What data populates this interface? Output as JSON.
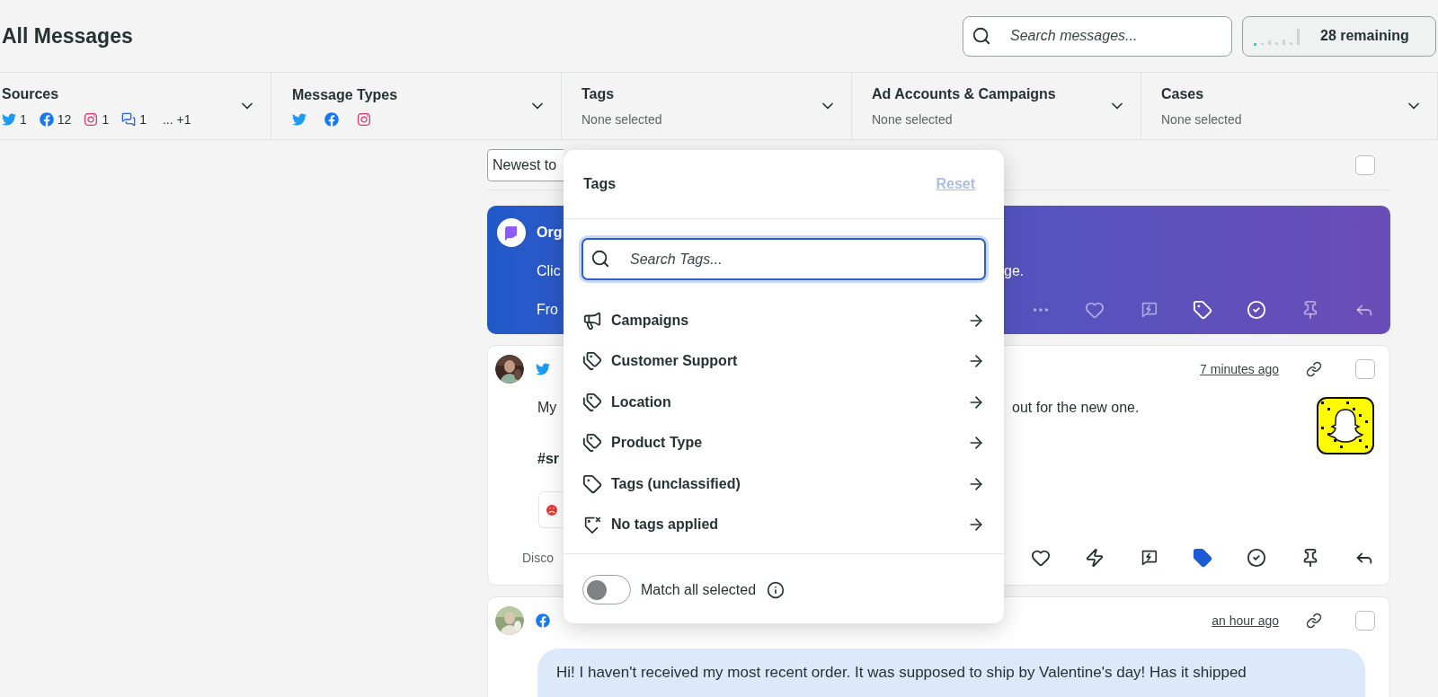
{
  "header": {
    "title": "All Messages",
    "search": {
      "placeholder": "Search messages..."
    },
    "remaining": {
      "label": "28 remaining"
    }
  },
  "filters": [
    {
      "title": "Sources",
      "kind": "sources",
      "sources": [
        {
          "kind": "twitter",
          "count": "1"
        },
        {
          "kind": "facebook",
          "count": "12"
        },
        {
          "kind": "instagram",
          "count": "1"
        },
        {
          "kind": "chat",
          "count": "1"
        }
      ],
      "more": "... +1"
    },
    {
      "title": "Message Types",
      "kind": "types",
      "types": [
        {
          "kind": "twitter"
        },
        {
          "kind": "facebook"
        },
        {
          "kind": "instagram"
        }
      ]
    },
    {
      "title": "Tags",
      "kind": "text",
      "summary": "None selected"
    },
    {
      "title": "Ad Accounts & Campaigns",
      "kind": "text",
      "summary": "None selected"
    },
    {
      "title": "Cases",
      "kind": "text",
      "summary": "None selected"
    }
  ],
  "sort": {
    "value": "Newest to",
    "checked": false
  },
  "messages": [
    {
      "kind": "banner",
      "title": "Org",
      "lines": [
        {
          "left": "Clic",
          "right": "ge."
        },
        {
          "left": "Fro"
        }
      ],
      "actions": [
        {
          "kind": "more",
          "active": false
        },
        {
          "kind": "heart",
          "active": false
        },
        {
          "kind": "bolt-message",
          "active": false
        },
        {
          "kind": "tag",
          "active": true
        },
        {
          "kind": "check",
          "active": true
        },
        {
          "kind": "pin",
          "active": false
        },
        {
          "kind": "reply",
          "active": false
        }
      ]
    },
    {
      "kind": "post",
      "network": {
        "kind": "twitter"
      },
      "time": "7 minutes ago",
      "checked": false,
      "lines": [
        {
          "left": "My",
          "right": "out for the new one.",
          "bold": false
        },
        {
          "left": "#sr",
          "bold": true
        }
      ],
      "reaction": {
        "kind": "sad"
      },
      "footer": "Disco",
      "attachment": {
        "kind": "picture"
      },
      "actions": [
        {
          "kind": "heart",
          "active": false
        },
        {
          "kind": "bolt",
          "active": false
        },
        {
          "kind": "bolt-message",
          "active": false
        },
        {
          "kind": "tag",
          "active": true
        },
        {
          "kind": "check",
          "active": false
        },
        {
          "kind": "pin",
          "active": false
        },
        {
          "kind": "reply",
          "active": false
        }
      ]
    },
    {
      "kind": "post",
      "network": {
        "kind": "facebook"
      },
      "time": "an hour ago",
      "checked": false,
      "bubble": "Hi! I haven't received my most recent order. It was supposed to ship by Valentine's day! Has it shipped"
    }
  ],
  "tags_popup": {
    "title": "Tags",
    "reset": "Reset",
    "search": {
      "placeholder": "Search Tags..."
    },
    "items": [
      {
        "label": "Campaigns",
        "kind": "campaign"
      },
      {
        "label": "Customer Support",
        "kind": "group"
      },
      {
        "label": "Location",
        "kind": "group"
      },
      {
        "label": "Product Type",
        "kind": "group"
      },
      {
        "label": "Tags (unclassified)",
        "kind": "tag"
      },
      {
        "label": "No tags applied",
        "kind": "none"
      }
    ],
    "match_all": {
      "label": "Match all selected",
      "on": false
    }
  }
}
